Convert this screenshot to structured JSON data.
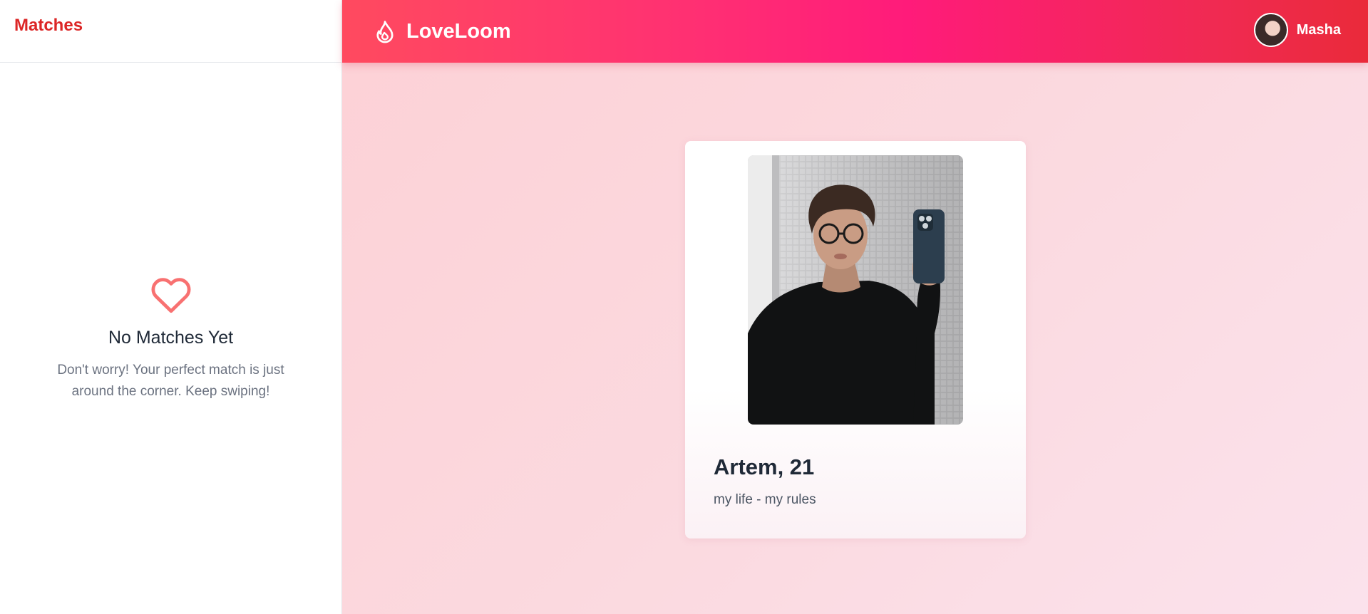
{
  "sidebar": {
    "title": "Matches",
    "empty_state": {
      "icon": "heart-outline-icon",
      "title": "No Matches Yet",
      "message": "Don't worry! Your perfect match is just around the corner. Keep swiping!"
    }
  },
  "header": {
    "brand_icon": "flame-icon",
    "brand_name": "LoveLoom",
    "user": {
      "name": "Masha"
    }
  },
  "profile_card": {
    "name_age": "Artem, 21",
    "bio": "my life - my rules"
  },
  "colors": {
    "accent": "#dc2626",
    "header_gradient_start": "#ff4a5f",
    "header_gradient_mid": "#ff1b7a",
    "header_gradient_end": "#ea2a3a",
    "heart_icon": "#f87171",
    "background_pink": "#fdd1d6"
  }
}
